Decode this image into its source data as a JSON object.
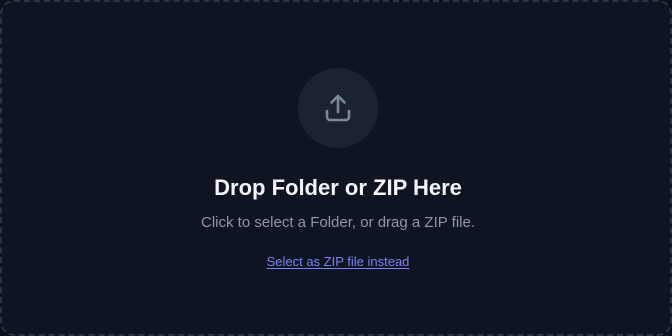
{
  "dropzone": {
    "icon": "upload-icon",
    "title": "Drop Folder or ZIP Here",
    "subtitle": "Click to select a Folder, or drag a ZIP file.",
    "zip_link_label": "Select as ZIP file instead"
  },
  "colors": {
    "background": "#0f1422",
    "border": "#2b3446",
    "icon_circle": "#1b2232",
    "icon": "#7e889b",
    "title": "#f3f5f9",
    "subtitle": "#8e97a8",
    "link": "#7b82f5"
  }
}
